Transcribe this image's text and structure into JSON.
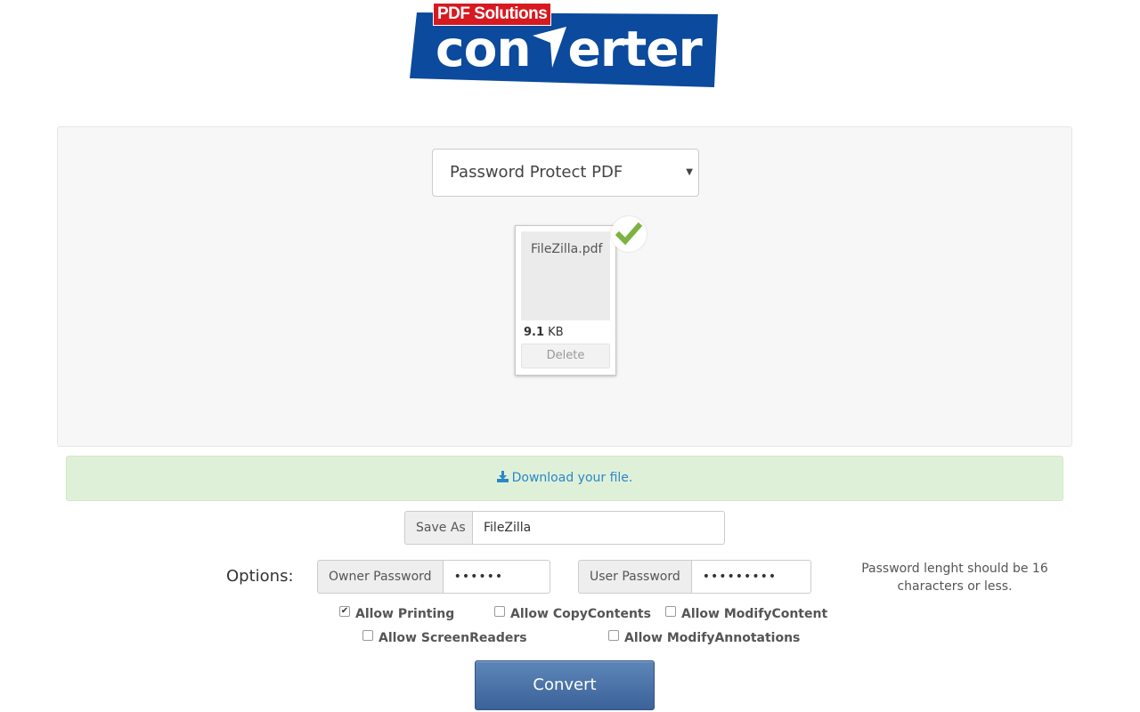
{
  "brand": {
    "tag": "PDF Solutions",
    "word_prefix": "con",
    "word_suffix": "erter",
    "banner_color": "#0b4a9c",
    "tag_color": "#d71920"
  },
  "tool_select": {
    "value": "Password Protect PDF"
  },
  "file": {
    "name": "FileZilla.pdf",
    "size_value": "9.1",
    "size_unit": "KB",
    "delete_label": "Delete",
    "status_icon": "check-icon"
  },
  "download": {
    "label": "Download your file.",
    "icon": "download-icon"
  },
  "save_as": {
    "label": "Save As",
    "value": "FileZilla"
  },
  "options": {
    "label": "Options:",
    "owner_password": {
      "label": "Owner Password",
      "value": "••••••"
    },
    "user_password": {
      "label": "User Password",
      "value": "•••••••••"
    },
    "note": "Password lenght should be 16 characters or less.",
    "checkboxes": [
      {
        "label": "Allow Printing",
        "checked": true
      },
      {
        "label": "Allow CopyContents",
        "checked": false
      },
      {
        "label": "Allow ModifyContent",
        "checked": false
      },
      {
        "label": "Allow ScreenReaders",
        "checked": false
      },
      {
        "label": "Allow ModifyAnnotations",
        "checked": false
      }
    ]
  },
  "convert": {
    "label": "Convert"
  },
  "colors": {
    "accent": "#2a87c8",
    "success_bg": "#dff0d8",
    "check_green": "#7cb342",
    "button_blue": "#4a72a8"
  }
}
